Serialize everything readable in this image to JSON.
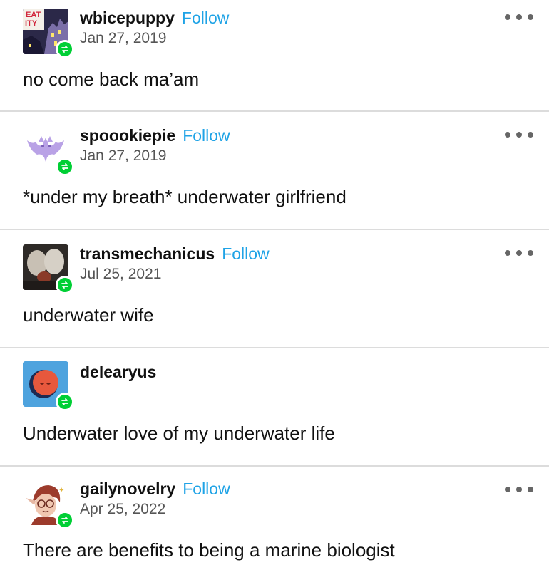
{
  "colors": {
    "follow": "#1fa3e6",
    "reblog_badge": "#00cf35",
    "divider": "#dcdcdc"
  },
  "posts": [
    {
      "username": "wbicepuppy",
      "follow_label": "Follow",
      "date": "Jan 27, 2019",
      "text": "no come back ma’am",
      "avatar_icon": "castle-avatar-icon"
    },
    {
      "username": "spoookiepie",
      "follow_label": "Follow",
      "date": "Jan 27, 2019",
      "text": "*under my breath* underwater girlfriend",
      "avatar_icon": "bat-avatar-icon"
    },
    {
      "username": "transmechanicus",
      "follow_label": "Follow",
      "date": "Jul 25, 2021",
      "text": "underwater wife",
      "avatar_icon": "photo-avatar-icon"
    },
    {
      "username": "delearyus",
      "text": "Underwater love of my underwater life",
      "avatar_icon": "moon-face-avatar-icon"
    },
    {
      "username": "gailynovelry",
      "follow_label": "Follow",
      "date": "Apr 25, 2022",
      "text": "There are benefits to being a marine biologist",
      "avatar_icon": "elf-character-avatar-icon"
    }
  ]
}
